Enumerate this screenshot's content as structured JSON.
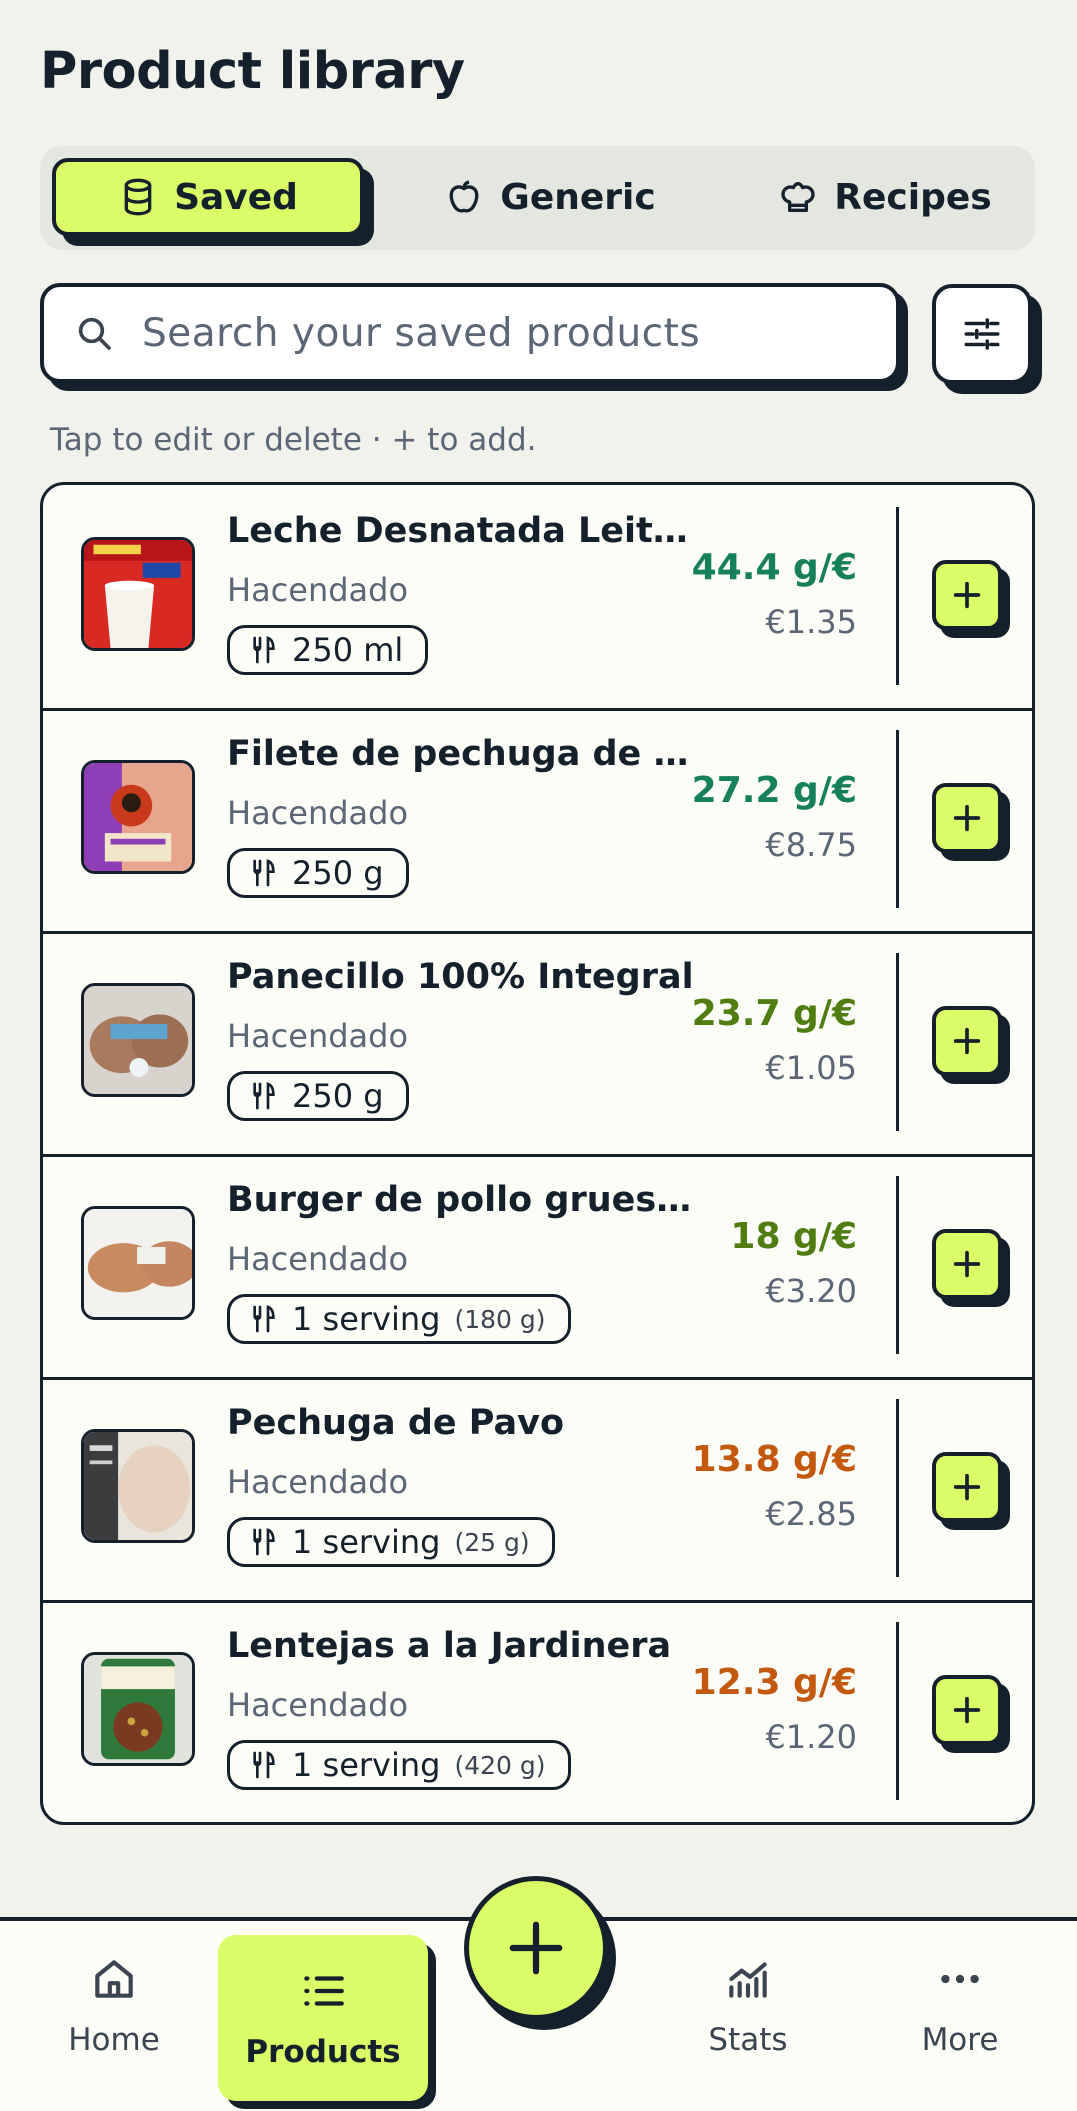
{
  "page": {
    "title": "Product library"
  },
  "tabs": [
    {
      "label": "Saved",
      "icon": "database-icon",
      "active": true
    },
    {
      "label": "Generic",
      "icon": "apple-icon",
      "active": false
    },
    {
      "label": "Recipes",
      "icon": "chef-hat-icon",
      "active": false
    }
  ],
  "search": {
    "placeholder": "Search your saved products",
    "value": ""
  },
  "hint": "Tap to edit or delete · + to add.",
  "products": [
    {
      "name": "Leche Desnatada Leite...",
      "brand": "Hacendado",
      "portion": "250 ml",
      "portion_grams": "",
      "ratio": "44.4 g/€",
      "ratio_color": "#15805a",
      "price": "€1.35"
    },
    {
      "name": "Filete de pechuga de p...",
      "brand": "Hacendado",
      "portion": "250 g",
      "portion_grams": "",
      "ratio": "27.2 g/€",
      "ratio_color": "#15805a",
      "price": "€8.75"
    },
    {
      "name": "Panecillo 100% Integral",
      "brand": "Hacendado",
      "portion": "250 g",
      "portion_grams": "",
      "ratio": "23.7 g/€",
      "ratio_color": "#4f7d12",
      "price": "€1.05"
    },
    {
      "name": "Burger de pollo gruesas",
      "brand": "Hacendado",
      "portion": "1 serving",
      "portion_grams": "(180 g)",
      "ratio": "18 g/€",
      "ratio_color": "#4f7d12",
      "price": "€3.20"
    },
    {
      "name": "Pechuga de Pavo",
      "brand": "Hacendado",
      "portion": "1 serving",
      "portion_grams": "(25 g)",
      "ratio": "13.8 g/€",
      "ratio_color": "#c2590f",
      "price": "€2.85"
    },
    {
      "name": "Lentejas a la Jardinera",
      "brand": "Hacendado",
      "portion": "1 serving",
      "portion_grams": "(420 g)",
      "ratio": "12.3 g/€",
      "ratio_color": "#c2590f",
      "price": "€1.20"
    }
  ],
  "nav": [
    {
      "label": "Home",
      "icon": "home-icon"
    },
    {
      "label": "Products",
      "icon": "list-icon",
      "active": true
    },
    {
      "label": "Stats",
      "icon": "chart-icon"
    },
    {
      "label": "More",
      "icon": "more-icon"
    }
  ],
  "colors": {
    "accent": "#d9fe67",
    "ink": "#14202b",
    "background": "#f1f2ec",
    "card": "#fdfdf8"
  }
}
